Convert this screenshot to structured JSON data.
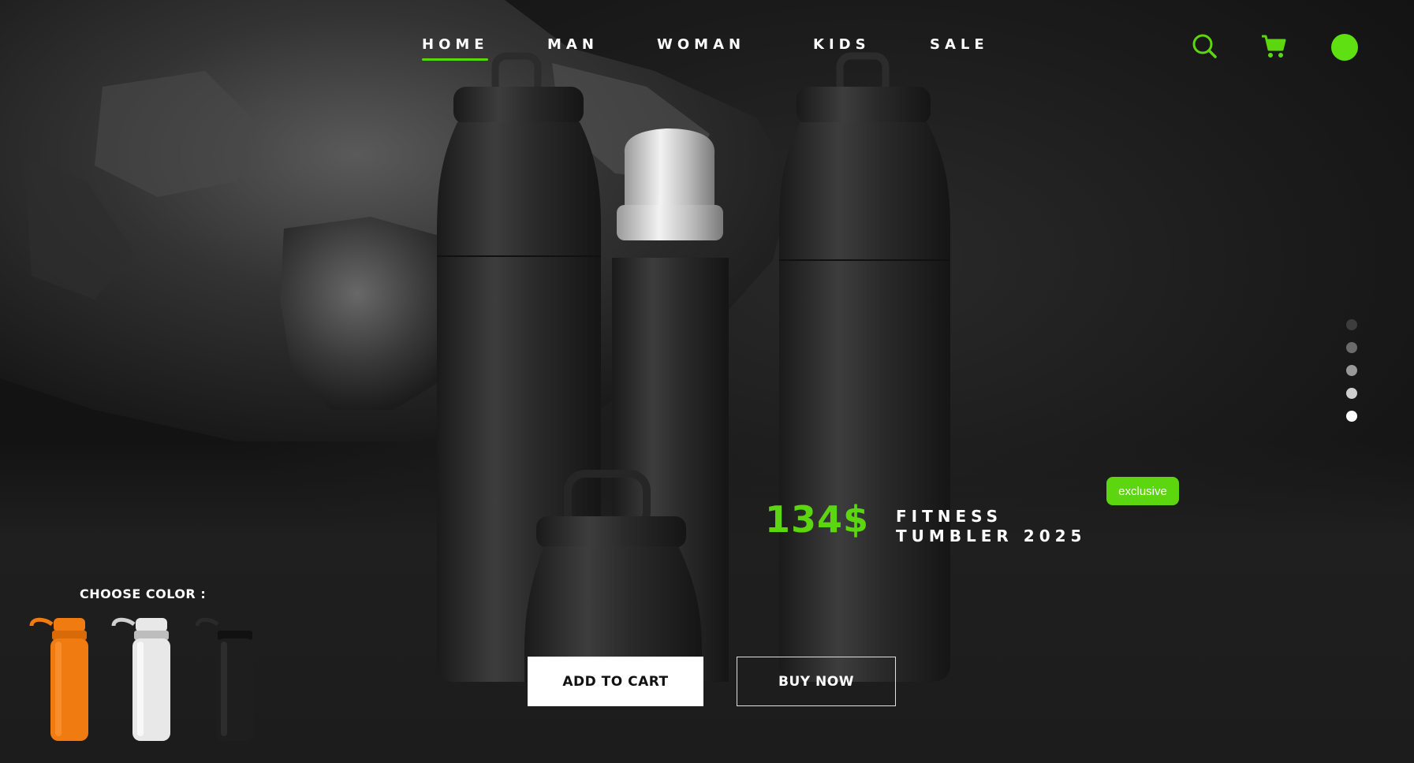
{
  "nav": {
    "items": [
      {
        "label": "HOME",
        "active": true
      },
      {
        "label": "MAN",
        "active": false
      },
      {
        "label": "WOMAN",
        "active": false
      },
      {
        "label": "KIDS",
        "active": false
      },
      {
        "label": "SALE",
        "active": false
      }
    ],
    "icons": [
      "search-icon",
      "cart-icon",
      "avatar"
    ]
  },
  "colors": {
    "accent": "#5cd60f",
    "background": "#1b1b1b",
    "text": "#ffffff"
  },
  "slider": {
    "total": 5,
    "active_index": 4
  },
  "product": {
    "badge": "exclusive",
    "price": "134$",
    "name_line1": "FITNESS",
    "name_line2": "TUMBLER 2025"
  },
  "actions": {
    "add_to_cart": "ADD TO CART",
    "buy_now": "BUY NOW"
  },
  "color_picker": {
    "label": "CHOOSE COLOR :",
    "options": [
      {
        "name": "orange",
        "hex": "#f07b10"
      },
      {
        "name": "white",
        "hex": "#e8e8e8"
      },
      {
        "name": "black",
        "hex": "#1e1e1e"
      }
    ]
  }
}
